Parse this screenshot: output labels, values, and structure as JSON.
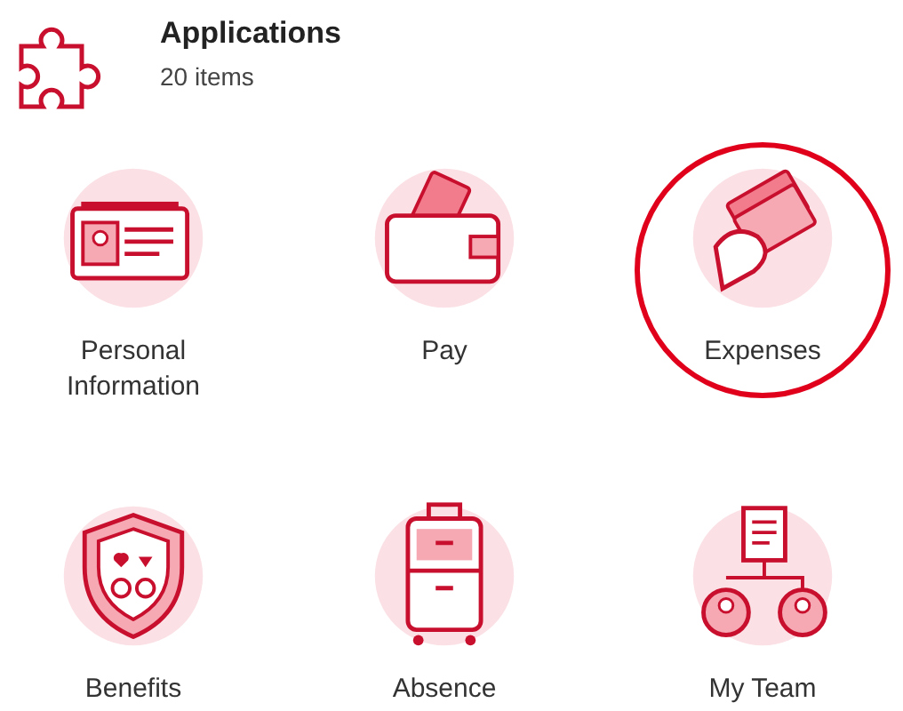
{
  "header": {
    "title": "Applications",
    "subtitle": "20 items"
  },
  "apps": [
    {
      "label": "Personal Information",
      "highlighted": false
    },
    {
      "label": "Pay",
      "highlighted": false
    },
    {
      "label": "Expenses",
      "highlighted": true
    },
    {
      "label": "Benefits",
      "highlighted": false
    },
    {
      "label": "Absence",
      "highlighted": false
    },
    {
      "label": "My Team",
      "highlighted": false
    }
  ]
}
